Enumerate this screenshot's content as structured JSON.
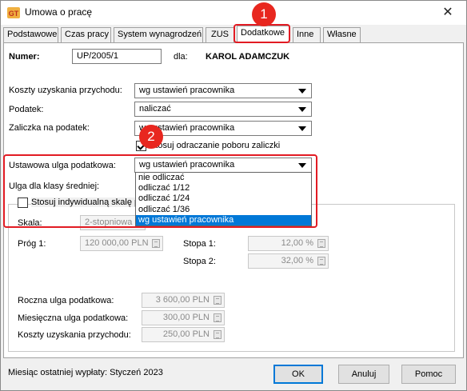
{
  "window": {
    "title": "Umowa o pracę",
    "close_glyph": "✕",
    "icon": "gt-app-icon"
  },
  "tabs": [
    {
      "label": "Podstawowe",
      "active": false
    },
    {
      "label": "Czas pracy",
      "active": false
    },
    {
      "label": "System wynagrodzeń",
      "active": false
    },
    {
      "label": "ZUS",
      "active": false
    },
    {
      "label": "Dodatkowe",
      "active": true
    },
    {
      "label": "Inne",
      "active": false
    },
    {
      "label": "Własne",
      "active": false
    }
  ],
  "header": {
    "numer_label": "Numer:",
    "numer_value": "UP/2005/1",
    "dla_label": "dla:",
    "employee": "KAROL ADAMCZUK"
  },
  "form": {
    "koszty_label": "Koszty uzyskania przychodu:",
    "koszty_value": "wg ustawień pracownika",
    "podatek_label": "Podatek:",
    "podatek_value": "naliczać",
    "zaliczka_label": "Zaliczka na podatek:",
    "zaliczka_value": "wg ustawień pracownika",
    "odraczanie_label": "Stosuj odraczanie poboru zaliczki",
    "odraczanie_checked": true,
    "ulga_label": "Ustawowa ulga podatkowa:",
    "ulga_value": "wg ustawień pracownika",
    "ulga_options": [
      "nie odliczać",
      "odliczać 1/12",
      "odliczać 1/24",
      "odliczać 1/36",
      "wg ustawień pracownika"
    ],
    "ulga_selected_index": 4,
    "klasa_label": "Ulga dla klasy średniej:",
    "indywidualna_label": "Stosuj indywidualną skalę p",
    "skala_label": "Skala:",
    "skala_value": "2-stopniowa",
    "prog1_label": "Próg 1:",
    "prog1_value": "120 000,00 PLN",
    "stopa1_label": "Stopa 1:",
    "stopa1_value": "12,00 %",
    "stopa2_label": "Stopa 2:",
    "stopa2_value": "32,00 %",
    "roczna_label": "Roczna ulga podatkowa:",
    "roczna_value": "3 600,00 PLN",
    "miesieczna_label": "Miesięczna ulga podatkowa:",
    "miesieczna_value": "300,00 PLN",
    "koszty2_label": "Koszty uzyskania przychodu:",
    "koszty2_value": "250,00 PLN"
  },
  "footer": {
    "status": "Miesiąc ostatniej wypłaty: Styczeń 2023",
    "ok": "OK",
    "cancel": "Anuluj",
    "help": "Pomoc"
  },
  "annotations": {
    "badge1": "1",
    "badge2": "2",
    "color": "#e21b23"
  },
  "colors": {
    "selection": "#0078d7",
    "annotation": "#e21b23"
  }
}
